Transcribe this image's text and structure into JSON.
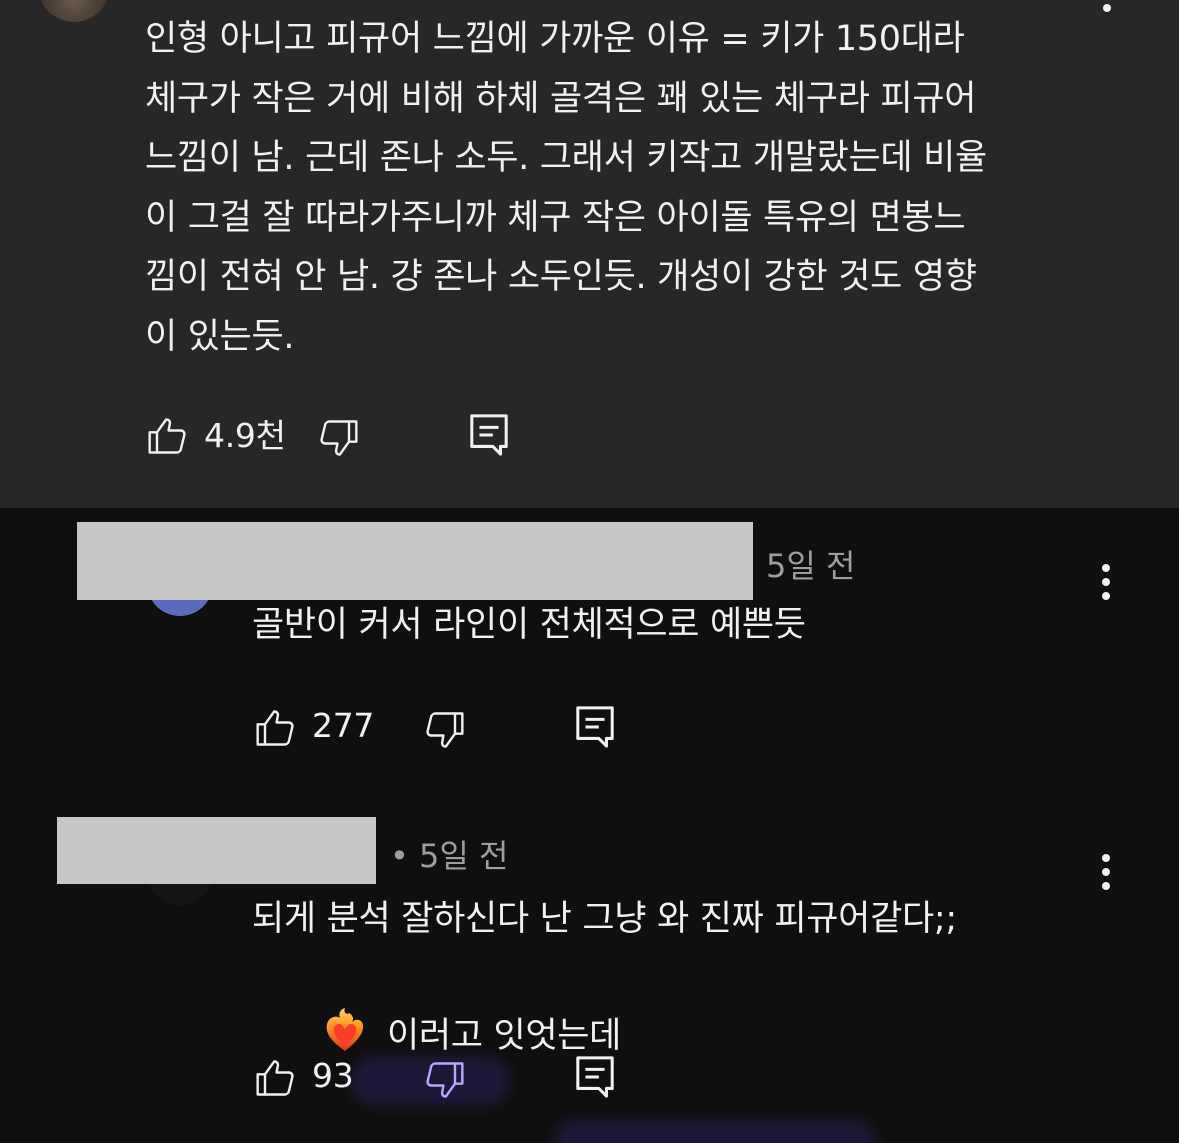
{
  "top_comment": {
    "body": "인형 아니고 피규어 느낌에 가까운 이유 = 키가 150대라\n체구가 작은 거에 비해 하체 골격은 꽤 있는 체구라 피규어\n느낌이 남. 근데 존나 소두. 그래서 키작고 개말랐는데 비율\n이 그걸 잘 따라가주니까 체구 작은 아이돌 특유의 면봉느\n낌이 전혀 안 남. 걍 존나 소두인듯. 개성이 강한 것도 영향\n이 있는듯.",
    "like_count": "4.9천"
  },
  "replies": [
    {
      "time": "5일 전",
      "body": "골반이 커서 라인이 전체적으로 예쁜듯",
      "like_count": "277",
      "avatar_color": "#5c6bc0"
    },
    {
      "time": "• 5일 전",
      "body_line1": "되게 분석 잘하신다 난 그냥 와 진짜 피규어같다;;",
      "body_line2": "이러고 잇엇는데",
      "like_count": "93",
      "avatar_color": "#141414"
    }
  ],
  "icons": {
    "like": "thumbs-up-icon",
    "dislike": "thumbs-down-icon",
    "reply": "comment-reply-icon",
    "more": "more-vert-icon",
    "emoji": "heart-on-fire-emoji"
  },
  "colors": {
    "highlight_bg": "#272727",
    "page_bg": "#0f0f0f",
    "text": "#f1f1f1",
    "secondary_text": "#9e9e9e",
    "redaction": "#c7c7c7"
  }
}
